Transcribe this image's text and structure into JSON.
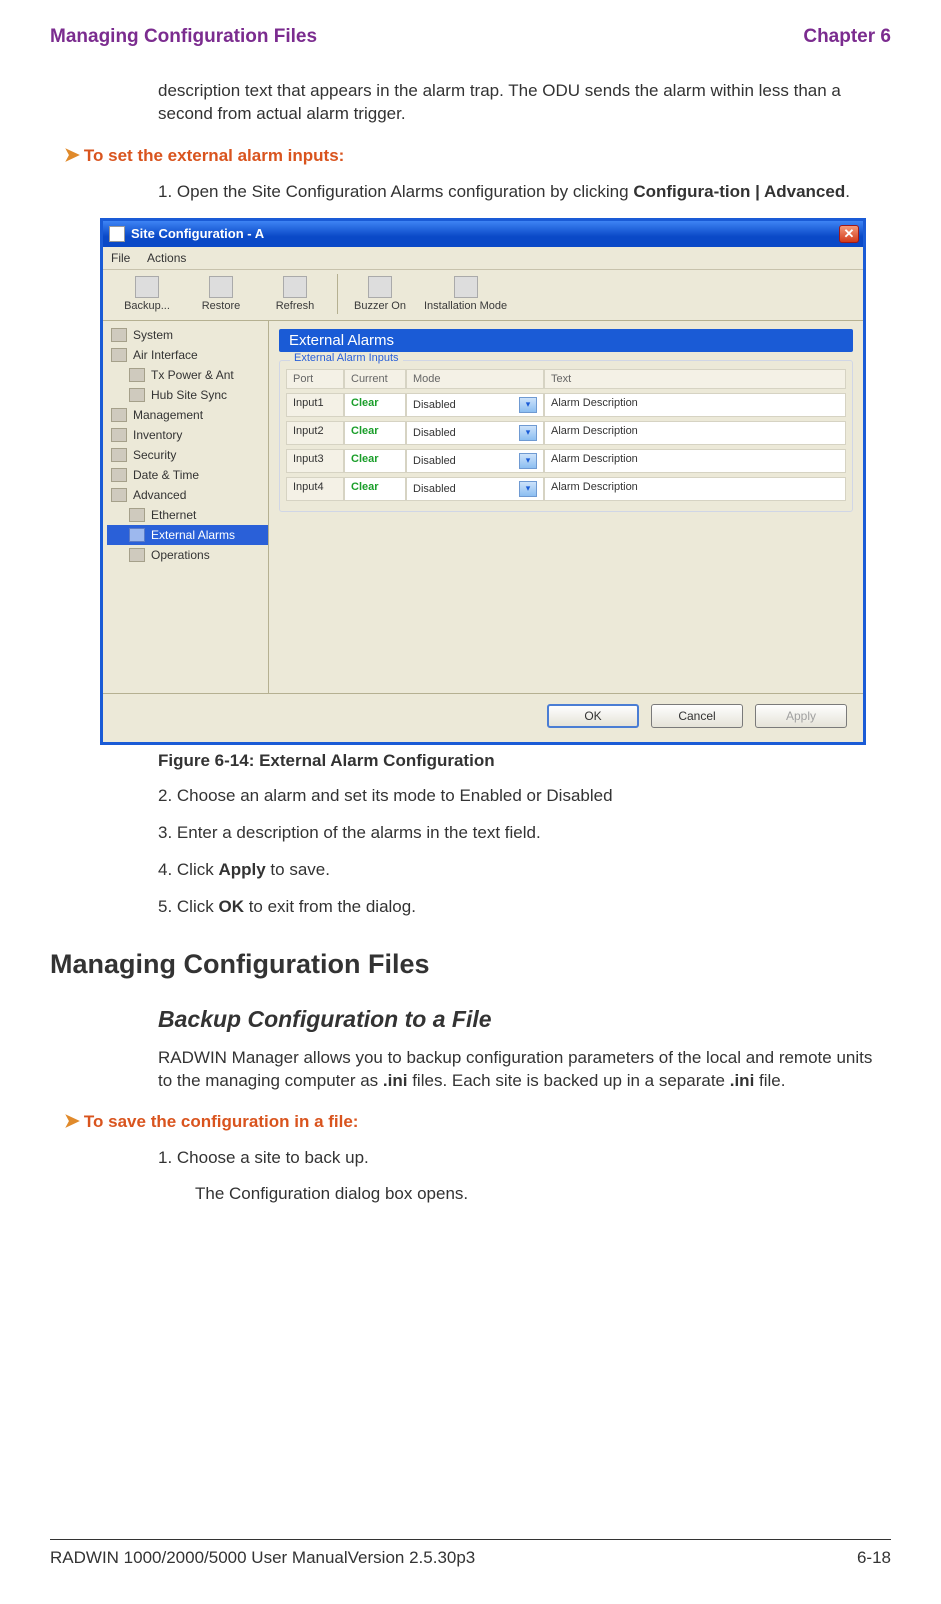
{
  "header": {
    "left": "Managing Configuration Files",
    "right": "Chapter 6"
  },
  "intro_para": "description text that appears in the alarm trap. The ODU sends the alarm within less than a second from actual alarm trigger.",
  "step_heading_1": "To set the external alarm inputs:",
  "step1_pre": "1. Open the Site Configuration Alarms configuration by clicking ",
  "step1_bold": "Configura-tion | Advanced",
  "step1_suffix": ".",
  "window": {
    "title": "Site Configuration - A",
    "menubar": {
      "file": "File",
      "actions": "Actions"
    },
    "toolbar": {
      "backup": "Backup...",
      "restore": "Restore",
      "refresh": "Refresh",
      "buzzer": "Buzzer On",
      "install": "Installation Mode"
    },
    "sidebar": {
      "system": "System",
      "air": "Air Interface",
      "txpower": "Tx Power & Ant",
      "hubsync": "Hub Site Sync",
      "management": "Management",
      "inventory": "Inventory",
      "security": "Security",
      "datetime": "Date & Time",
      "advanced": "Advanced",
      "ethernet": "Ethernet",
      "extalarms": "External Alarms",
      "operations": "Operations"
    },
    "panel": {
      "title": "External Alarms",
      "group_title": "External Alarm Inputs",
      "cols": {
        "port": "Port",
        "current": "Current",
        "mode": "Mode",
        "text": "Text"
      },
      "rows": [
        {
          "port": "Input1",
          "current": "Clear",
          "mode": "Disabled",
          "text": "Alarm Description"
        },
        {
          "port": "Input2",
          "current": "Clear",
          "mode": "Disabled",
          "text": "Alarm Description"
        },
        {
          "port": "Input3",
          "current": "Clear",
          "mode": "Disabled",
          "text": "Alarm Description"
        },
        {
          "port": "Input4",
          "current": "Clear",
          "mode": "Disabled",
          "text": "Alarm Description"
        }
      ]
    },
    "buttons": {
      "ok": "OK",
      "cancel": "Cancel",
      "apply": "Apply"
    }
  },
  "fig_caption": "Figure 6-14: External Alarm Configuration",
  "step2": "2. Choose an alarm and set its mode to Enabled or Disabled",
  "step3": "3. Enter a description of the alarms in the text field.",
  "step4_pre": "4. Click ",
  "step4_bold": "Apply",
  "step4_suf": " to save.",
  "step5_pre": "5. Click ",
  "step5_bold": "OK",
  "step5_suf": " to exit from the dialog.",
  "h1": "Managing Configuration Files",
  "h2": "Backup Configuration to a File",
  "backup_para_pre": "RADWIN Manager allows you to backup configuration parameters of the local and remote units to the managing computer as ",
  "ini1": ".ini",
  "backup_para_mid": " files. Each site is backed up in a separate ",
  "ini2": ".ini",
  "backup_para_suf": " file.",
  "step_heading_2": "To save the configuration in a file:",
  "save_step1": "1. Choose a site to back up.",
  "save_step1_sub": "The Configuration dialog box opens.",
  "footer": {
    "left": "RADWIN 1000/2000/5000 User ManualVersion  2.5.30p3",
    "right": "6-18"
  }
}
